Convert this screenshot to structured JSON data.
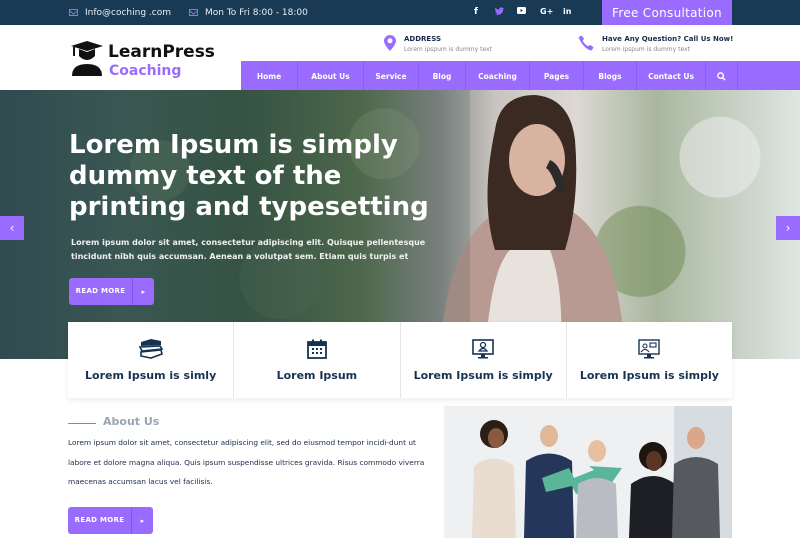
{
  "topbar": {
    "email": "Info@coching .com",
    "hours": "Mon To Fri  8:00 - 18:00",
    "social": [
      {
        "icon": "facebook-icon",
        "glyph": "f"
      },
      {
        "icon": "twitter-icon",
        "glyph": "🐦"
      },
      {
        "icon": "youtube-icon",
        "glyph": "▶"
      },
      {
        "icon": "google-plus-icon",
        "glyph": "G+"
      },
      {
        "icon": "linkedin-icon",
        "glyph": "in"
      }
    ],
    "cta": "Free Consultation"
  },
  "header": {
    "logo_title": "LearnPress",
    "logo_subtitle": "Coaching",
    "address": {
      "title": "ADDRESS",
      "text": "Lorem ipspum is dummy text"
    },
    "phone": {
      "title": "Have Any Question? Call Us Now!",
      "text": "Lorem ipspum is dummy text"
    }
  },
  "nav": {
    "items": [
      "Home",
      "About Us",
      "Service",
      "Blog",
      "Coaching",
      "Pages",
      "Blogs",
      "Contact Us"
    ],
    "search_glyph": "🔍"
  },
  "hero": {
    "heading": "Lorem Ipsum is simply dummy text of the printing and typesetting",
    "text": "Lorem ipsum dolor sit amet, consectetur adipiscing elit. Quisque pellentesque tincidunt nibh quis accumsan. Aenean a volutpat sem. Etiam quis turpis et",
    "button": "READ MORE",
    "arrow": "▸",
    "prev": "‹",
    "next": "›"
  },
  "features": [
    {
      "icon": "books-icon",
      "label": "Lorem Ipsum is simly"
    },
    {
      "icon": "calendar-icon",
      "label": "Lorem Ipsum"
    },
    {
      "icon": "monitor-user-icon",
      "label": "Lorem Ipsum is simply"
    },
    {
      "icon": "video-conference-icon",
      "label": "Lorem Ipsum is simply"
    }
  ],
  "about": {
    "heading": "About Us",
    "text": "Lorem ipsum dolor sit amet, consectetur adipiscing elit, sed do eiusmod tempor incidi-dunt ut labore et dolore magna aliqua. Quis ipsum suspendisse ultrices gravida. Risus commodo viverra maecenas accumsan lacus vel facilisis.",
    "button": "READ MORE",
    "arrow": "▸"
  },
  "colors": {
    "accent": "#9a6bff",
    "navy": "#183a54",
    "heading": "#163352"
  }
}
